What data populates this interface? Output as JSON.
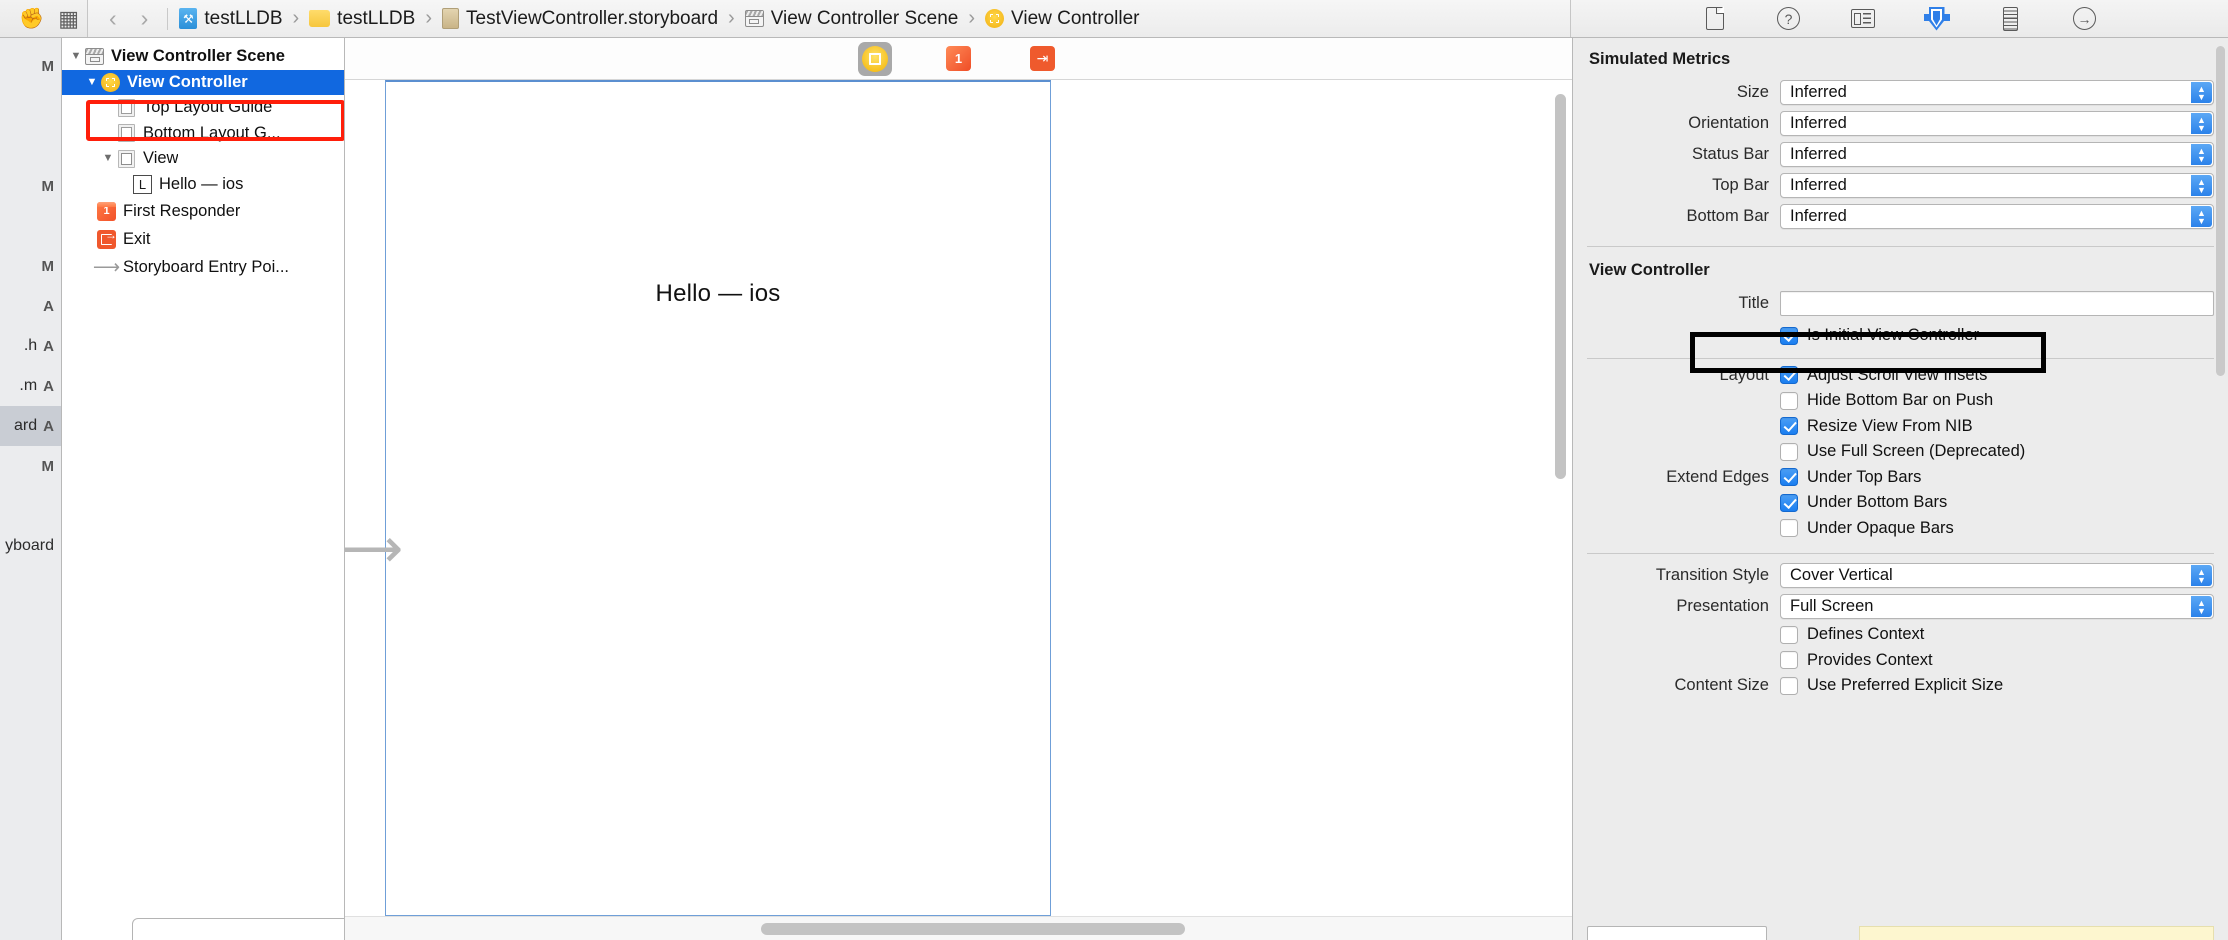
{
  "topbar": {
    "left_icons": [
      {
        "name": "comment-icon",
        "glyph": "💬"
      },
      {
        "name": "grid-view-icon",
        "glyph": "⌸"
      }
    ],
    "back_label": "‹",
    "forward_label": "›",
    "breadcrumbs": [
      {
        "label": "testLLDB",
        "icon": "xcode-project-icon"
      },
      {
        "label": "testLLDB",
        "icon": "folder-icon"
      },
      {
        "label": "TestViewController.storyboard",
        "icon": "storyboard-file-icon"
      },
      {
        "label": "View Controller Scene",
        "icon": "scene-icon"
      },
      {
        "label": "View Controller",
        "icon": "view-controller-icon"
      }
    ],
    "separator": "›",
    "inspector_tabs": [
      {
        "name": "file-inspector-tab",
        "icon": "file-icon",
        "selected": false
      },
      {
        "name": "quick-help-inspector-tab",
        "icon": "help-icon",
        "selected": false
      },
      {
        "name": "identity-inspector-tab",
        "icon": "identity-card-icon",
        "selected": false
      },
      {
        "name": "attributes-inspector-tab",
        "icon": "attributes-icon",
        "selected": true
      },
      {
        "name": "size-inspector-tab",
        "icon": "ruler-icon",
        "selected": false
      },
      {
        "name": "connections-inspector-tab",
        "icon": "arrow-circle-icon",
        "selected": false
      }
    ]
  },
  "navigator_strip": {
    "rows": [
      {
        "name": "",
        "status": "M"
      },
      {
        "name": "",
        "status": ""
      },
      {
        "name": "",
        "status": ""
      },
      {
        "name": "",
        "status": "M"
      },
      {
        "name": "",
        "status": ""
      },
      {
        "name": "",
        "status": "M"
      },
      {
        "name": "",
        "status": "A"
      },
      {
        "name": ".h",
        "status": "A"
      },
      {
        "name": ".m",
        "status": "A"
      },
      {
        "name": "ard",
        "status": "A",
        "selected": true
      },
      {
        "name": "",
        "status": "M"
      },
      {
        "name": "",
        "status": ""
      },
      {
        "name": "yboard",
        "status": ""
      }
    ]
  },
  "outline": {
    "rows": [
      {
        "label": "View Controller Scene",
        "icon": "scene-icon",
        "indent": 0,
        "disclosure": "▼",
        "bold": true,
        "selected": false
      },
      {
        "label": "View Controller",
        "icon": "view-controller-icon",
        "indent": 1,
        "disclosure": "▼",
        "bold": true,
        "selected": true
      },
      {
        "label": "Top Layout Guide",
        "icon": "layout-guide-icon",
        "indent": 2,
        "disclosure": "",
        "bold": false,
        "selected": false
      },
      {
        "label": "Bottom Layout G...",
        "icon": "layout-guide-bottom-icon",
        "indent": 2,
        "disclosure": "",
        "bold": false,
        "selected": false
      },
      {
        "label": "View",
        "icon": "view-icon",
        "indent": 2,
        "disclosure": "▼",
        "bold": false,
        "selected": false
      },
      {
        "label": "Hello — ios",
        "icon": "label-icon",
        "indent": 3,
        "disclosure": "",
        "bold": false,
        "selected": false
      },
      {
        "label": "First Responder",
        "icon": "first-responder-icon",
        "indent": 1,
        "disclosure": "",
        "bold": false,
        "selected": false
      },
      {
        "label": "Exit",
        "icon": "exit-icon",
        "indent": 1,
        "disclosure": "",
        "bold": false,
        "selected": false
      },
      {
        "label": "Storyboard Entry Poi...",
        "icon": "entry-point-arrow-icon",
        "indent": 1,
        "disclosure": "",
        "bold": false,
        "selected": false
      }
    ],
    "annotation_color": "#ff1e0a"
  },
  "canvas": {
    "dock_items": [
      {
        "name": "scene-dock-view-controller",
        "icon": "view-controller-icon",
        "selected": true
      },
      {
        "name": "scene-dock-first-responder",
        "icon": "first-responder-icon",
        "selected": false
      },
      {
        "name": "scene-dock-exit",
        "icon": "exit-icon",
        "selected": false
      }
    ],
    "scene_label": "Hello — ios",
    "entry_arrow": "⟶"
  },
  "inspector": {
    "simulated_metrics": {
      "title": "Simulated Metrics",
      "fields": [
        {
          "label": "Size",
          "value": "Inferred",
          "name": "simulated-size-select"
        },
        {
          "label": "Orientation",
          "value": "Inferred",
          "name": "simulated-orientation-select"
        },
        {
          "label": "Status Bar",
          "value": "Inferred",
          "name": "simulated-status-bar-select"
        },
        {
          "label": "Top Bar",
          "value": "Inferred",
          "name": "simulated-top-bar-select"
        },
        {
          "label": "Bottom Bar",
          "value": "Inferred",
          "name": "simulated-bottom-bar-select"
        }
      ]
    },
    "view_controller": {
      "title": "View Controller",
      "title_field": {
        "label": "Title",
        "value": "",
        "placeholder": "",
        "name": "vc-title-field"
      },
      "is_initial": {
        "label": "Is Initial View Controller",
        "checked": true,
        "name": "is-initial-view-controller-checkbox"
      },
      "checkbox_groups": [
        {
          "group_label": "Layout",
          "items": [
            {
              "label": "Adjust Scroll View Insets",
              "checked": true,
              "name": "adjust-scroll-view-insets-checkbox"
            },
            {
              "label": "Hide Bottom Bar on Push",
              "checked": false,
              "name": "hide-bottom-bar-on-push-checkbox"
            },
            {
              "label": "Resize View From NIB",
              "checked": true,
              "name": "resize-view-from-nib-checkbox"
            },
            {
              "label": "Use Full Screen (Deprecated)",
              "checked": false,
              "name": "use-full-screen-checkbox"
            }
          ]
        },
        {
          "group_label": "Extend Edges",
          "items": [
            {
              "label": "Under Top Bars",
              "checked": true,
              "name": "under-top-bars-checkbox"
            },
            {
              "label": "Under Bottom Bars",
              "checked": true,
              "name": "under-bottom-bars-checkbox"
            },
            {
              "label": "Under Opaque Bars",
              "checked": false,
              "name": "under-opaque-bars-checkbox"
            }
          ]
        }
      ],
      "transition_style": {
        "label": "Transition Style",
        "value": "Cover Vertical",
        "name": "transition-style-select"
      },
      "presentation": {
        "label": "Presentation",
        "value": "Full Screen",
        "name": "presentation-select"
      },
      "context_checks": [
        {
          "group_label": "",
          "label": "Defines Context",
          "checked": false,
          "name": "defines-context-checkbox"
        },
        {
          "group_label": "",
          "label": "Provides Context",
          "checked": false,
          "name": "provides-context-checkbox"
        },
        {
          "group_label": "Content Size",
          "label": "Use Preferred Explicit Size",
          "checked": false,
          "name": "use-preferred-explicit-size-checkbox"
        }
      ],
      "annotation_color": "#000000"
    }
  },
  "colors": {
    "selection_blue": "#1168e0",
    "checkbox_blue": "#1a7ef0",
    "stepper_blue": "#2b82ea",
    "annotation_red": "#ff1e0a",
    "annotation_black": "#000000",
    "panel_gray": "#ececec"
  }
}
